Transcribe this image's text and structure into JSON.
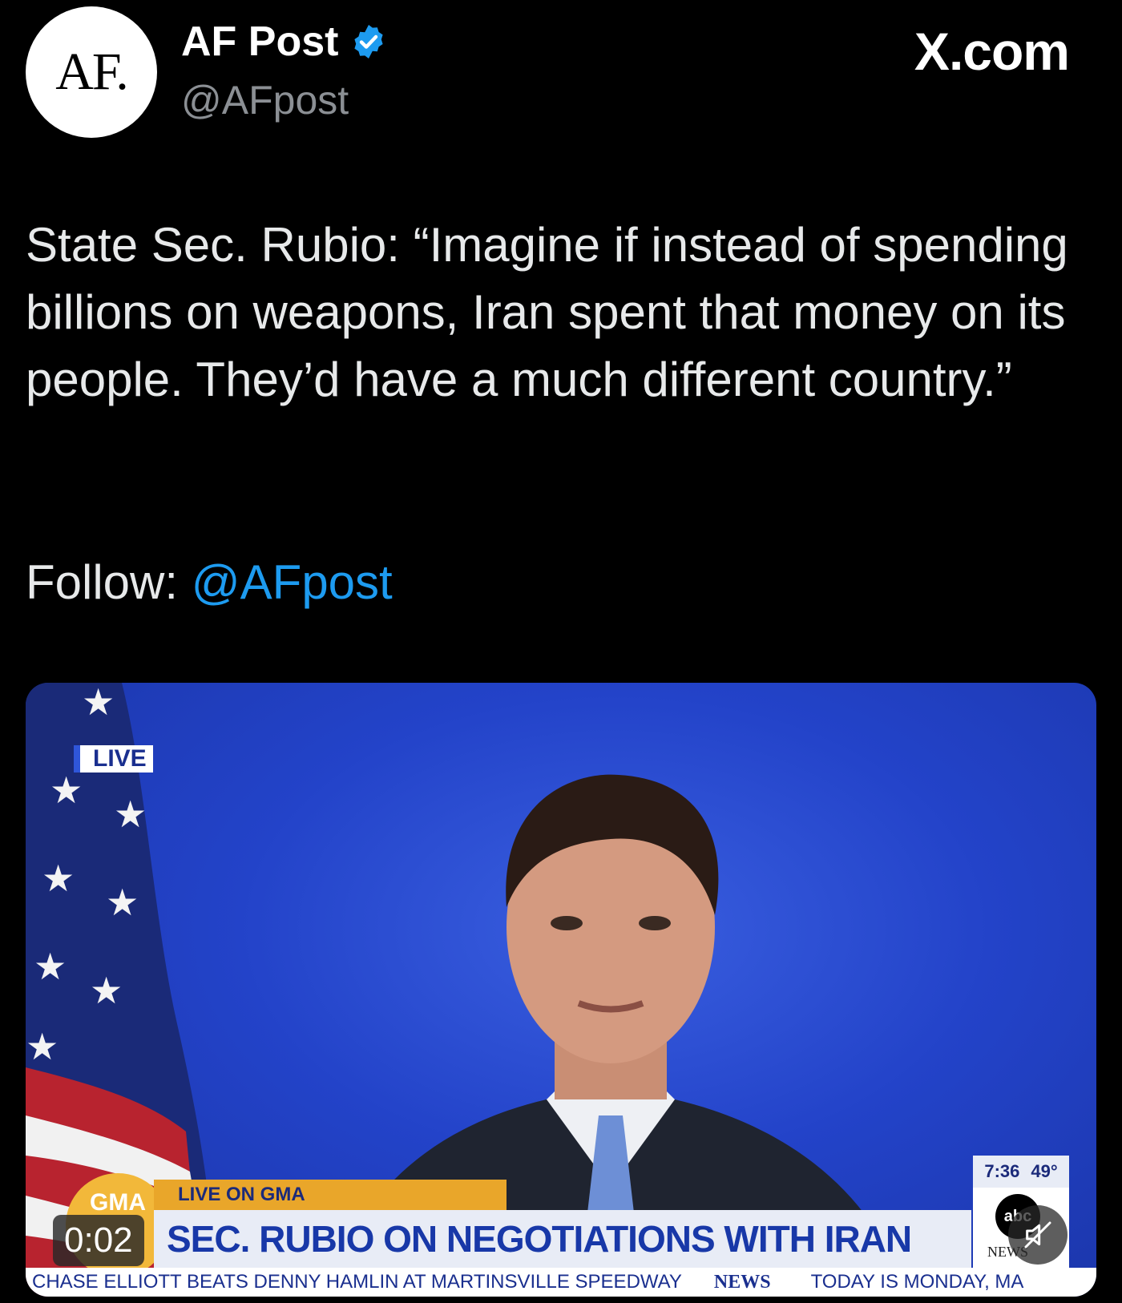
{
  "author": {
    "avatar_text": "AF.",
    "display_name": "AF Post",
    "handle": "@AFpost"
  },
  "site_mark": "X.com",
  "tweet": {
    "text": "State Sec. Rubio: “Imagine if instead of spending billions on weapons, Iran spent that money on its people. They’d have a much different country.”",
    "follow_label": "Follow:",
    "follow_handle": "@AFpost"
  },
  "video": {
    "live_badge": "LIVE",
    "gma_logo": "GMA",
    "segment_label": "LIVE ON GMA",
    "headline": "SEC. RUBIO ON NEGOTIATIONS WITH IRAN",
    "clock": "7:36",
    "temperature": "49°",
    "network_logo": "abc",
    "network_sub": "NEWS",
    "ticker": {
      "story": "CHASE ELLIOTT BEATS DENNY HAMLIN AT MARTINSVILLE SPEEDWAY",
      "brand": "NEWS",
      "today": "TODAY IS MONDAY, MA"
    },
    "timestamp": "0:02",
    "mute_icon": "speaker-muted-icon"
  },
  "colors": {
    "background": "#000000",
    "link": "#1d9bf0",
    "verified": "#1d9bf0",
    "studio_blue": "#2343c9"
  }
}
